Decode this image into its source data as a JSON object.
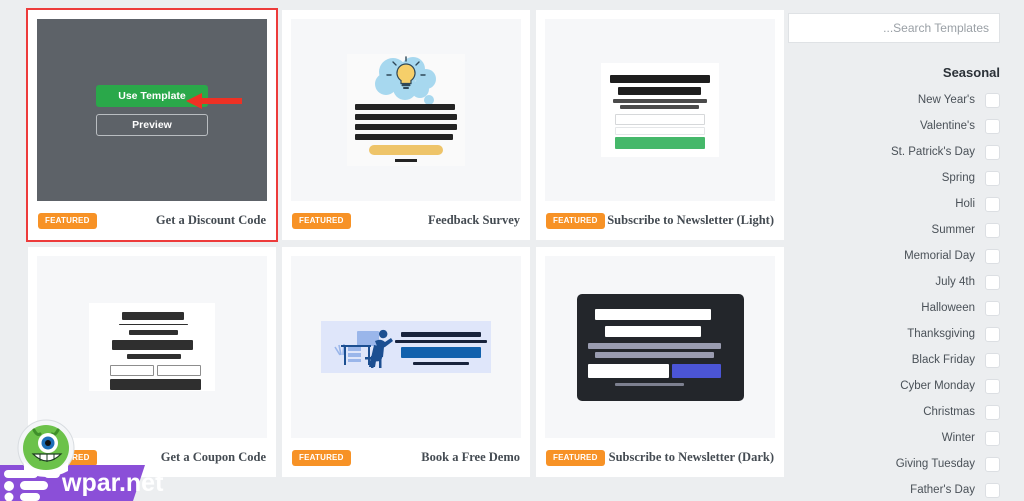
{
  "accent_colors": {
    "badge_orange": "#f79226",
    "selection_red": "#ed3b3b",
    "use_template_green": "#2aa84a",
    "overlay_gray": "#5d6268",
    "page_background": "#eceef0",
    "card_background": "#ffffff",
    "thumb_background": "#f6f7f9",
    "watermark_purple": "#8b4fd8"
  },
  "templates": [
    {
      "title": "Get a Discount Code",
      "badge": "FEATURED",
      "selected": true,
      "hover_overlay": {
        "use_template_label": "Use Template",
        "preview_label": "Preview"
      }
    },
    {
      "title": "Feedback Survey",
      "badge": "FEATURED",
      "selected": false
    },
    {
      "title": "Subscribe to Newsletter (Light)",
      "badge": "FEATURED",
      "selected": false
    },
    {
      "title": "Get a Coupon Code",
      "badge": "FEATURED",
      "selected": false
    },
    {
      "title": "Book a Free Demo",
      "badge": "FEATURED",
      "selected": false
    },
    {
      "title": "Subscribe to Newsletter (Dark)",
      "badge": "FEATURED",
      "selected": false
    }
  ],
  "sidebar": {
    "search": {
      "value": "",
      "placeholder": "...Search Templates"
    },
    "section_title": "Seasonal",
    "filters": [
      {
        "label": "New Year's",
        "checked": false
      },
      {
        "label": "Valentine's",
        "checked": false
      },
      {
        "label": "St. Patrick's Day",
        "checked": false
      },
      {
        "label": "Spring",
        "checked": false
      },
      {
        "label": "Holi",
        "checked": false
      },
      {
        "label": "Summer",
        "checked": false
      },
      {
        "label": "Memorial Day",
        "checked": false
      },
      {
        "label": "July 4th",
        "checked": false
      },
      {
        "label": "Halloween",
        "checked": false
      },
      {
        "label": "Thanksgiving",
        "checked": false
      },
      {
        "label": "Black Friday",
        "checked": false
      },
      {
        "label": "Cyber Monday",
        "checked": false
      },
      {
        "label": "Christmas",
        "checked": false
      },
      {
        "label": "Winter",
        "checked": false
      },
      {
        "label": "Giving Tuesday",
        "checked": false
      },
      {
        "label": "Father's Day",
        "checked": false
      }
    ]
  },
  "watermark": {
    "text": "wpar.net"
  }
}
